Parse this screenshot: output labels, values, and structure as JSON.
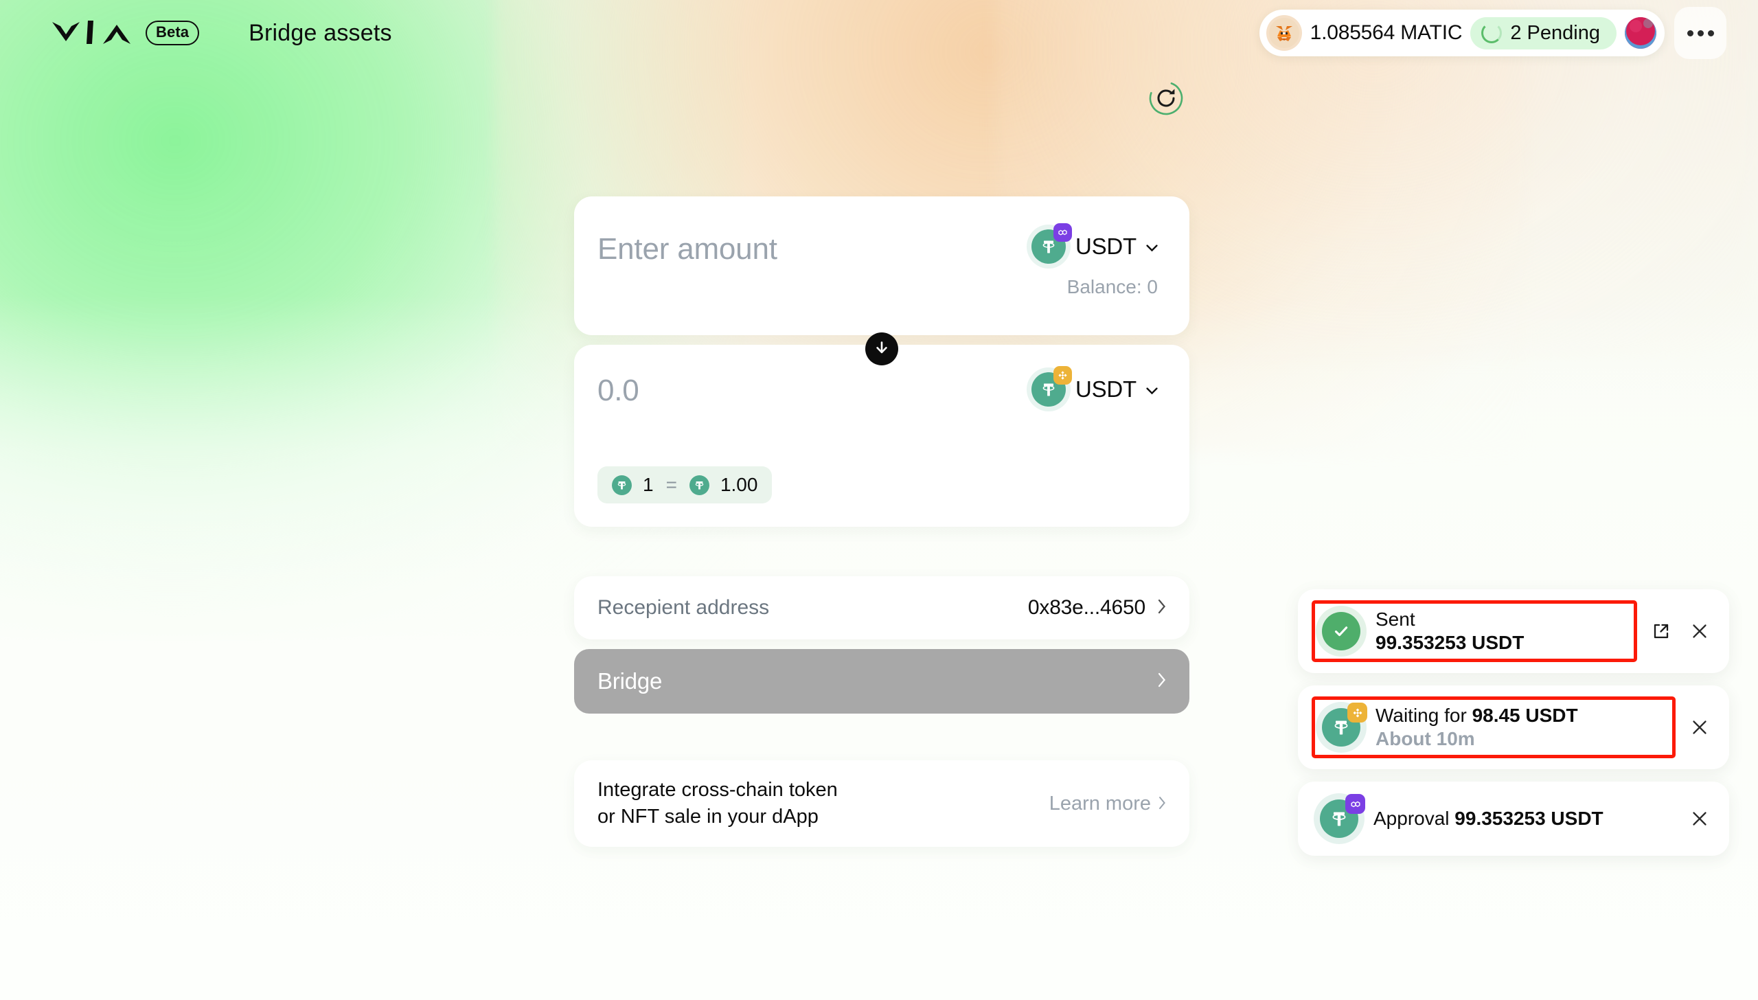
{
  "header": {
    "brand_name": "VIA",
    "beta_label": "Beta",
    "page_title": "Bridge assets",
    "wallet_balance": "1.085564 MATIC",
    "pending_label": "2 Pending",
    "wallet_icon": "metamask-fox-icon",
    "spinner_icon": "loading-spinner-icon",
    "avatar_icon": "user-avatar",
    "more_icon": "more-horizontal-icon"
  },
  "toolbar": {
    "refresh_icon": "refresh-icon"
  },
  "bridge": {
    "from": {
      "amount_placeholder": "Enter amount",
      "token_symbol": "USDT",
      "token_icon": "tether-icon",
      "chain_badge": "polygon-icon",
      "chain_badge_color": "#7b3fe4",
      "balance_label": "Balance: 0",
      "chevron_icon": "chevron-down-icon"
    },
    "swap_icon": "arrow-down-icon",
    "to": {
      "amount_value": "0.0",
      "token_symbol": "USDT",
      "token_icon": "tether-icon",
      "chain_badge": "binance-icon",
      "chain_badge_color": "#edb338",
      "chevron_icon": "chevron-down-icon"
    },
    "rate": {
      "from_amount": "1",
      "equals": "=",
      "to_amount": "1.00",
      "from_icon": "tether-icon",
      "to_icon": "tether-icon"
    },
    "recipient": {
      "label": "Recepient address",
      "address": "0x83e...4650",
      "chevron_icon": "chevron-right-icon"
    },
    "submit": {
      "label": "Bridge",
      "chevron_icon": "chevron-right-icon",
      "disabled_color": "#a8a8a8"
    }
  },
  "promo": {
    "line1": "Integrate cross-chain token",
    "line2": "or NFT sale in your dApp",
    "link_label": "Learn more",
    "link_chevron": "chevron-right-icon"
  },
  "toasts": [
    {
      "status_icon": "check-circle-icon",
      "title": "Sent",
      "subtitle": "99.353253 USDT",
      "subtitle_bold": true,
      "highlighted": true,
      "has_external_link": true,
      "external_icon": "external-link-icon",
      "close_icon": "close-icon"
    },
    {
      "status_icon": "tether-icon",
      "chain_badge": "binance-icon",
      "chain_badge_color": "#edb338",
      "title_prefix": "Waiting for ",
      "title_bold": "98.45 USDT",
      "subtitle": "About 10m",
      "highlighted": true,
      "has_external_link": false,
      "close_icon": "close-icon"
    },
    {
      "status_icon": "tether-icon",
      "chain_badge": "polygon-icon",
      "chain_badge_color": "#7b3fe4",
      "title_prefix": "Approval ",
      "title_bold": "99.353253 USDT",
      "subtitle": "",
      "highlighted": false,
      "has_external_link": false,
      "close_icon": "close-icon"
    }
  ],
  "colors": {
    "accent_green": "#5bbd6a",
    "highlight_red": "#fc1a08",
    "tether_green": "#4fab8e",
    "polygon_purple": "#7b3fe4",
    "binance_gold": "#edb338"
  }
}
